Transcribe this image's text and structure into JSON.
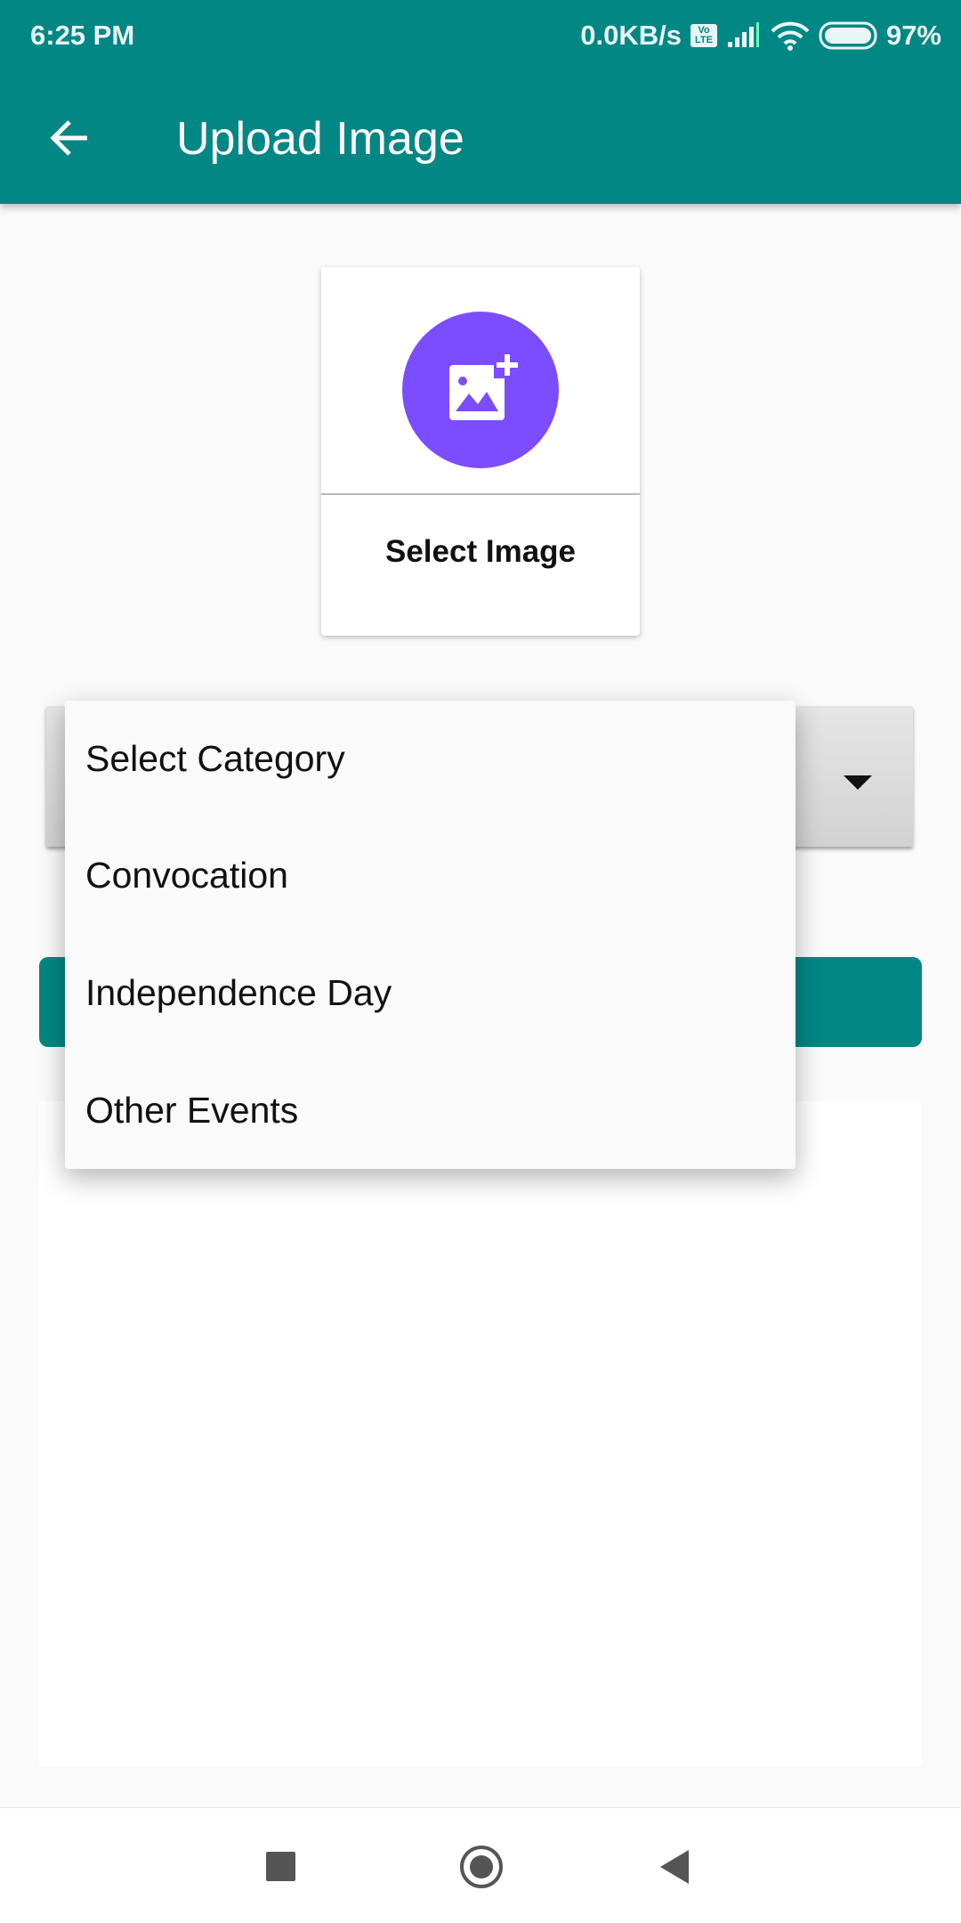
{
  "status_bar": {
    "time": "6:25 PM",
    "net_speed": "0.0KB/s",
    "volte": "Vo LTE",
    "battery": "97%"
  },
  "app_bar": {
    "title": "Upload Image"
  },
  "select_image": {
    "label": "Select Image"
  },
  "dropdown": {
    "options": [
      "Select Category",
      "Convocation",
      "Independence Day",
      "Other Events"
    ]
  },
  "colors": {
    "primary": "#028784",
    "accent": "#7c4dff"
  }
}
